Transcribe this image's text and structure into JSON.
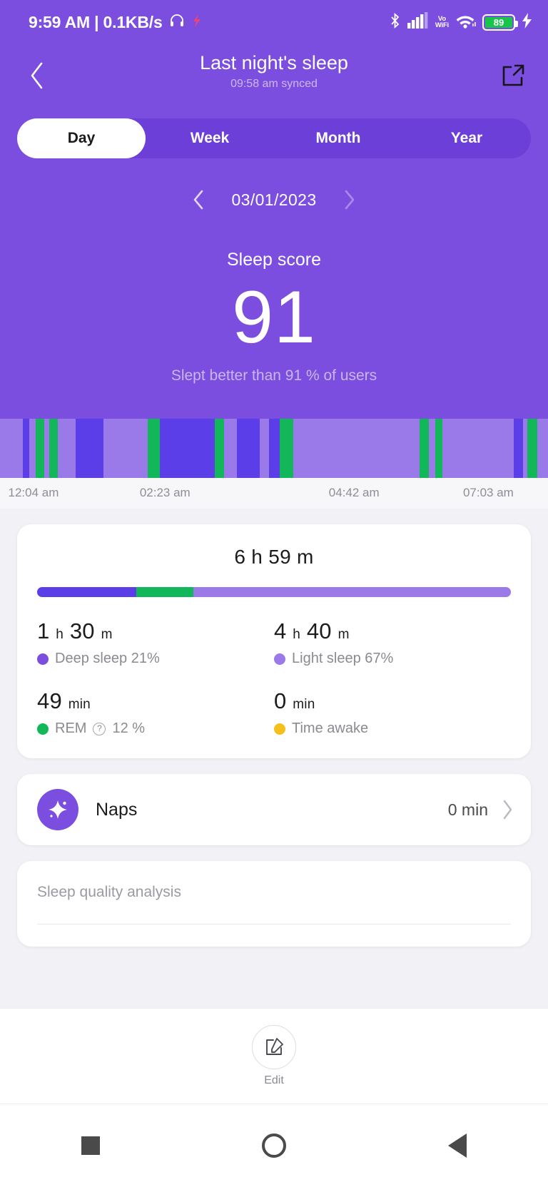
{
  "status_bar": {
    "time": "9:59 AM | 0.1KB/s",
    "headphone_icon": "headphone-icon",
    "notification_icon": "notification-icon",
    "bluetooth_icon": "bluetooth-icon",
    "signal_icon": "cellular-signal-icon",
    "vowifi_line1": "Vo",
    "vowifi_line2": "WiFi",
    "wifi_icon": "wifi-icon",
    "battery_level": "89",
    "charging_icon": "charging-bolt-icon"
  },
  "app_bar": {
    "back_icon": "back-chevron-icon",
    "title": "Last night's sleep",
    "subtitle": "09:58 am synced",
    "share_icon": "share-external-icon"
  },
  "tabs": {
    "items": [
      {
        "label": "Day",
        "active": true
      },
      {
        "label": "Week",
        "active": false
      },
      {
        "label": "Month",
        "active": false
      },
      {
        "label": "Year",
        "active": false
      }
    ]
  },
  "date_nav": {
    "prev_icon": "chevron-left-icon",
    "date": "03/01/2023",
    "next_icon": "chevron-right-icon"
  },
  "sleep_score": {
    "title": "Sleep score",
    "value": "91",
    "caption": "Slept better than 91 % of users"
  },
  "colors": {
    "hero_purple": "#7b4ee0",
    "deep_sleep": "#5b3ee8",
    "light_sleep": "#9a7ae8",
    "rem": "#12b75a",
    "awake": "#f5c01e",
    "accent": "#7b4ee0"
  },
  "chart_data": {
    "type": "bar",
    "title": "Sleep stages hypnogram",
    "xlabel": "",
    "ylabel": "",
    "legend_position": "none",
    "grid": false,
    "x_tick_labels": [
      "12:04 am",
      "02:23 am",
      "04:42 am",
      "07:03 am"
    ],
    "x_tick_positions_pct": [
      1.5,
      25.5,
      60.0,
      84.5
    ],
    "stage_colors": {
      "deep": "#5b3ee8",
      "light": "#9a7ae8",
      "rem": "#12b75a",
      "awake": "#f5c01e"
    },
    "categories": [
      "Deep sleep",
      "Light sleep",
      "REM",
      "Time awake"
    ],
    "values": [
      21,
      67,
      12,
      0
    ],
    "value_unit": "percent",
    "segments": [
      {
        "stage": "light",
        "width_pct": 4.3
      },
      {
        "stage": "deep",
        "width_pct": 1.2
      },
      {
        "stage": "light",
        "width_pct": 1.3
      },
      {
        "stage": "rem",
        "width_pct": 1.6
      },
      {
        "stage": "light",
        "width_pct": 0.9
      },
      {
        "stage": "rem",
        "width_pct": 1.7
      },
      {
        "stage": "light",
        "width_pct": 3.4
      },
      {
        "stage": "deep",
        "width_pct": 5.3
      },
      {
        "stage": "light",
        "width_pct": 8.4
      },
      {
        "stage": "rem",
        "width_pct": 2.3
      },
      {
        "stage": "deep",
        "width_pct": 10.5
      },
      {
        "stage": "rem",
        "width_pct": 1.7
      },
      {
        "stage": "light",
        "width_pct": 2.4
      },
      {
        "stage": "deep",
        "width_pct": 4.4
      },
      {
        "stage": "light",
        "width_pct": 1.8
      },
      {
        "stage": "deep",
        "width_pct": 2.0
      },
      {
        "stage": "rem",
        "width_pct": 2.6
      },
      {
        "stage": "light",
        "width_pct": 24.0
      },
      {
        "stage": "rem",
        "width_pct": 1.7
      },
      {
        "stage": "light",
        "width_pct": 1.3
      },
      {
        "stage": "rem",
        "width_pct": 1.3
      },
      {
        "stage": "light",
        "width_pct": 13.6
      },
      {
        "stage": "deep",
        "width_pct": 1.8
      },
      {
        "stage": "light",
        "width_pct": 0.8
      },
      {
        "stage": "rem",
        "width_pct": 1.9
      },
      {
        "stage": "light",
        "width_pct": 2.0
      }
    ]
  },
  "duration_card": {
    "total": "6 h 59 m",
    "stage_bar": [
      {
        "stage": "deep",
        "pct": 21
      },
      {
        "stage": "rem",
        "pct": 12
      },
      {
        "stage": "light",
        "pct": 67
      }
    ],
    "stats": [
      {
        "value_main": "1",
        "unit_1": "h",
        "value_2": "30",
        "unit_2": "m",
        "label": "Deep sleep 21%",
        "dot_color": "#7b4ee0",
        "has_info_icon": false
      },
      {
        "value_main": "4",
        "unit_1": "h",
        "value_2": "40",
        "unit_2": "m",
        "label": "Light sleep 67%",
        "dot_color": "#9a7ae8",
        "has_info_icon": false
      },
      {
        "value_main": "49",
        "unit_1": "min",
        "value_2": "",
        "unit_2": "",
        "label_before": "REM",
        "label_after": "12 %",
        "label": "REM 12 %",
        "dot_color": "#12b75a",
        "has_info_icon": true
      },
      {
        "value_main": "0",
        "unit_1": "min",
        "value_2": "",
        "unit_2": "",
        "label": "Time awake",
        "dot_color": "#f5c01e",
        "has_info_icon": false
      }
    ]
  },
  "naps_card": {
    "icon": "nap-star-icon",
    "label": "Naps",
    "value": "0 min",
    "chevron_icon": "chevron-right-icon"
  },
  "quality_card": {
    "title": "Sleep quality analysis"
  },
  "edit_bar": {
    "icon": "edit-pencil-icon",
    "label": "Edit"
  },
  "nav_bar": {
    "recents_icon": "square-recents-icon",
    "home_icon": "circle-home-icon",
    "back_icon": "triangle-back-icon"
  }
}
